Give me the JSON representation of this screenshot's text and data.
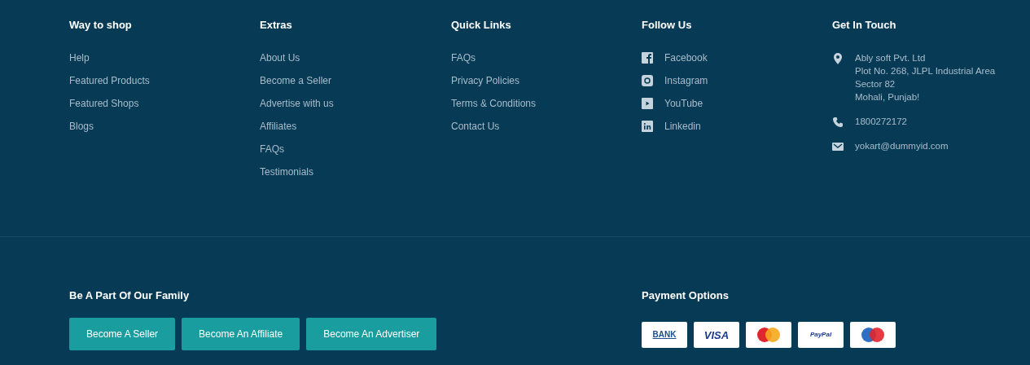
{
  "columns": [
    {
      "heading": "Way to shop",
      "links": [
        "Help",
        "Featured Products",
        "Featured Shops",
        "Blogs"
      ]
    },
    {
      "heading": "Extras",
      "links": [
        "About Us",
        "Become a Seller",
        "Advertise with us",
        "Affiliates",
        "FAQs",
        "Testimonials"
      ]
    },
    {
      "heading": "Quick Links",
      "links": [
        "FAQs",
        "Privacy Policies",
        "Terms & Conditions",
        "Contact Us"
      ]
    }
  ],
  "follow": {
    "heading": "Follow Us",
    "items": [
      {
        "kind": "facebook",
        "label": "Facebook"
      },
      {
        "kind": "instagram",
        "label": "Instagram"
      },
      {
        "kind": "youtube",
        "label": "YouTube"
      },
      {
        "kind": "linkedin",
        "label": "Linkedin"
      }
    ]
  },
  "contact": {
    "heading": "Get In Touch",
    "items": [
      {
        "kind": "address",
        "lines": [
          "Ably soft Pvt. Ltd",
          "Plot No. 268, JLPL Industrial Area",
          "Sector 82",
          "Mohali, Punjab!"
        ]
      },
      {
        "kind": "phone",
        "lines": [
          "1800272172"
        ]
      },
      {
        "kind": "email",
        "lines": [
          "yokart@dummyid.com"
        ]
      }
    ]
  },
  "family": {
    "heading": "Be A Part Of Our Family",
    "buttons": [
      "Become A Seller",
      "Become An Affiliate",
      "Become An Advertiser"
    ]
  },
  "payment": {
    "heading": "Payment Options",
    "methods": [
      {
        "kind": "bank",
        "label": "BANK"
      },
      {
        "kind": "visa",
        "label": "VISA"
      },
      {
        "kind": "mastercard"
      },
      {
        "kind": "paypal",
        "label": "PayPal"
      },
      {
        "kind": "maestro"
      }
    ]
  }
}
